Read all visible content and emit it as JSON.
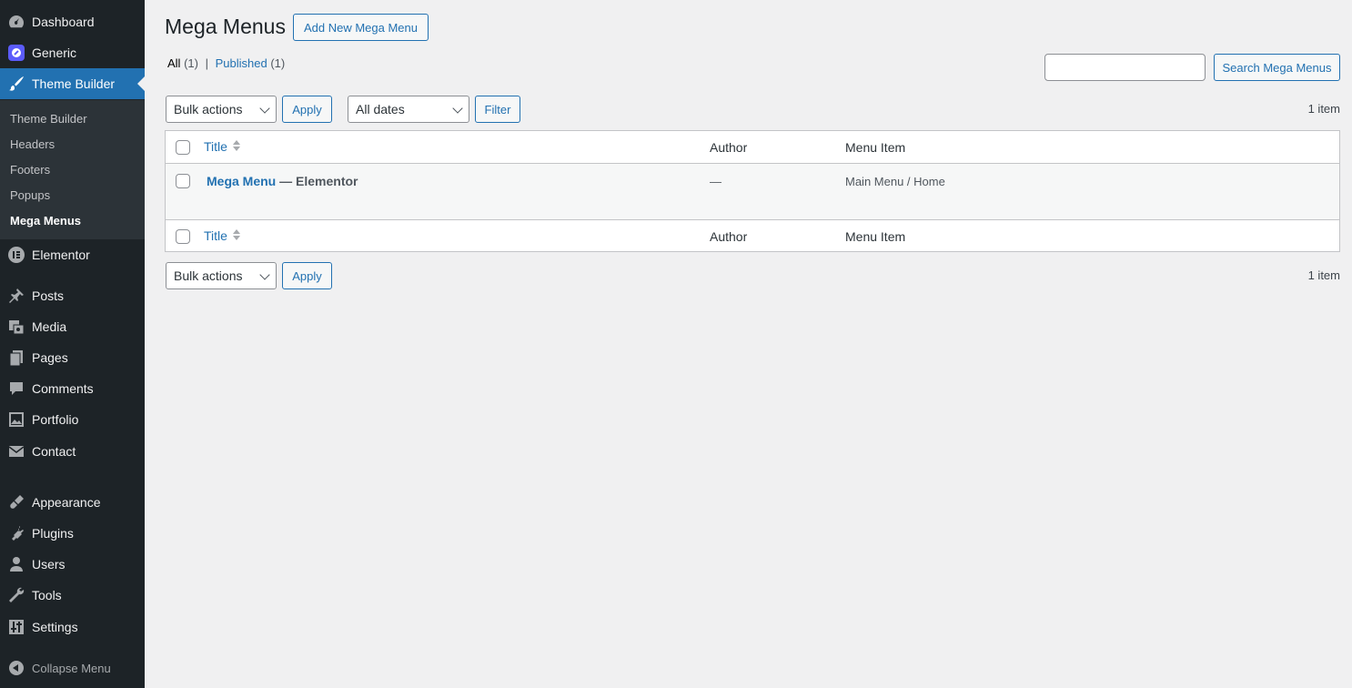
{
  "sidebar": {
    "items": [
      {
        "label": "Dashboard",
        "icon": "dashboard-icon"
      },
      {
        "label": "Generic",
        "icon": "generic-icon"
      },
      {
        "label": "Theme Builder",
        "icon": "brush-icon"
      },
      {
        "label": "Elementor",
        "icon": "elementor-icon"
      },
      {
        "label": "Posts",
        "icon": "pin-icon"
      },
      {
        "label": "Media",
        "icon": "media-icon"
      },
      {
        "label": "Pages",
        "icon": "pages-icon"
      },
      {
        "label": "Comments",
        "icon": "comments-icon"
      },
      {
        "label": "Portfolio",
        "icon": "portfolio-icon"
      },
      {
        "label": "Contact",
        "icon": "envelope-icon"
      },
      {
        "label": "Appearance",
        "icon": "appearance-icon"
      },
      {
        "label": "Plugins",
        "icon": "plugins-icon"
      },
      {
        "label": "Users",
        "icon": "users-icon"
      },
      {
        "label": "Tools",
        "icon": "wrench-icon"
      },
      {
        "label": "Settings",
        "icon": "settings-icon"
      }
    ],
    "submenu": [
      "Theme Builder",
      "Headers",
      "Footers",
      "Popups",
      "Mega Menus"
    ],
    "collapse_label": "Collapse Menu",
    "accent_color": "#2271b1"
  },
  "header": {
    "title": "Mega Menus",
    "add_new_label": "Add New Mega Menu"
  },
  "views": {
    "all_label": "All",
    "all_count": "(1)",
    "separator": "|",
    "published_label": "Published",
    "published_count": "(1)"
  },
  "search": {
    "button_label": "Search Mega Menus",
    "value": ""
  },
  "toolbar": {
    "bulk_actions": "Bulk actions",
    "apply_label": "Apply",
    "dates": "All dates",
    "filter_label": "Filter",
    "items_count": "1 item"
  },
  "table": {
    "columns": {
      "title": "Title",
      "author": "Author",
      "menu_item": "Menu Item"
    },
    "rows": [
      {
        "title": "Mega Menu",
        "state": "— Elementor",
        "author": "—",
        "menu_item": "Main Menu / Home"
      }
    ]
  }
}
